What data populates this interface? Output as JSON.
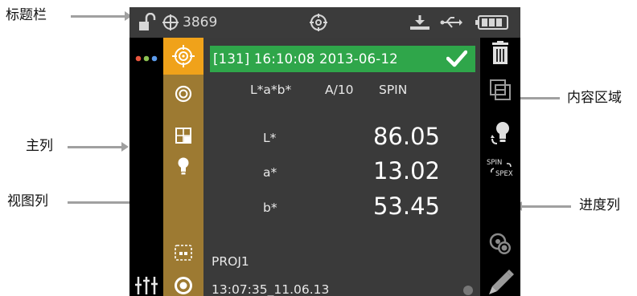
{
  "callouts": {
    "title_bar": "标题栏",
    "main_column": "主列",
    "view_column": "视图列",
    "content_area": "内容区域",
    "progress_column": "进度列"
  },
  "title_bar": {
    "count": "3869",
    "icons": [
      "unlock-icon",
      "crosshair-count-icon",
      "target-icon",
      "download-icon",
      "usb-icon",
      "battery-icon"
    ]
  },
  "main_column": {
    "icons": [
      "dots-menu-icon",
      "sliders-icon"
    ],
    "dot_colors": [
      "#e9573f",
      "#8cc152",
      "#5d9cec"
    ]
  },
  "view_column": {
    "icons": [
      "target-view-icon",
      "circle-target-icon",
      "grid-view-icon",
      "lightbulb-icon",
      "dashed-aperture-icon",
      "ring-icon"
    ],
    "selected_color": "#f0a21a",
    "column_color": "#9d7a32"
  },
  "content": {
    "measurement_header": "[131] 16:10:08 2013-06-12",
    "header_color": "#2fa64a",
    "color_space": "L*a*b*",
    "illuminant": "A/10",
    "mode": "SPIN",
    "rows": [
      {
        "label": "L*",
        "value": "86.05"
      },
      {
        "label": "a*",
        "value": "13.02"
      },
      {
        "label": "b*",
        "value": "53.45"
      }
    ],
    "project": "PROJ1",
    "timestamp": "13:07:35_11.06.13"
  },
  "progress_column": {
    "icons": [
      "trash-icon",
      "compare-icon",
      "illuminant-switch-icon",
      "spin-spex-icon",
      "target-settings-icon",
      "pencil-icon"
    ],
    "spin_label": "SPIN",
    "spex_label": "SPEX"
  }
}
